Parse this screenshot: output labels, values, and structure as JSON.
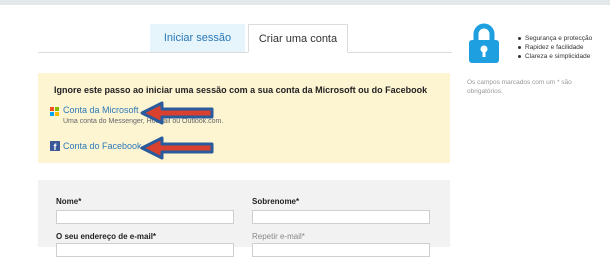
{
  "tabs": {
    "login": "Iniciar sessão",
    "create": "Criar uma conta"
  },
  "social": {
    "title": "Ignore este passo ao iniciar uma sessão com a sua conta da Microsoft ou do Facebook",
    "microsoft_link": "Conta da Microsoft",
    "microsoft_sub": "Uma conta do Messenger, Hotmail ou Outlook.com.",
    "facebook_link": "Conta do Facebook"
  },
  "form": {
    "first_name_label": "Nome*",
    "last_name_label": "Sobrenome*",
    "email_label": "O seu endereço de e-mail*",
    "repeat_email_label": "Repetir e-mail*"
  },
  "benefits": [
    "Segurança e protecção",
    "Rapidez e facilidade",
    "Clareza e simplicidade"
  ],
  "note": "Os campos marcados com um * são obrigatórios.",
  "colors": {
    "link": "#2b79b8",
    "lock": "#1e9fe0",
    "arrow_fill": "#d9412e",
    "arrow_outline": "#2a5b9c",
    "yellow_bg": "#fdf4d2"
  },
  "icons": [
    "lock-icon",
    "microsoft-logo-icon",
    "facebook-logo-icon",
    "arrow-left-icon"
  ]
}
